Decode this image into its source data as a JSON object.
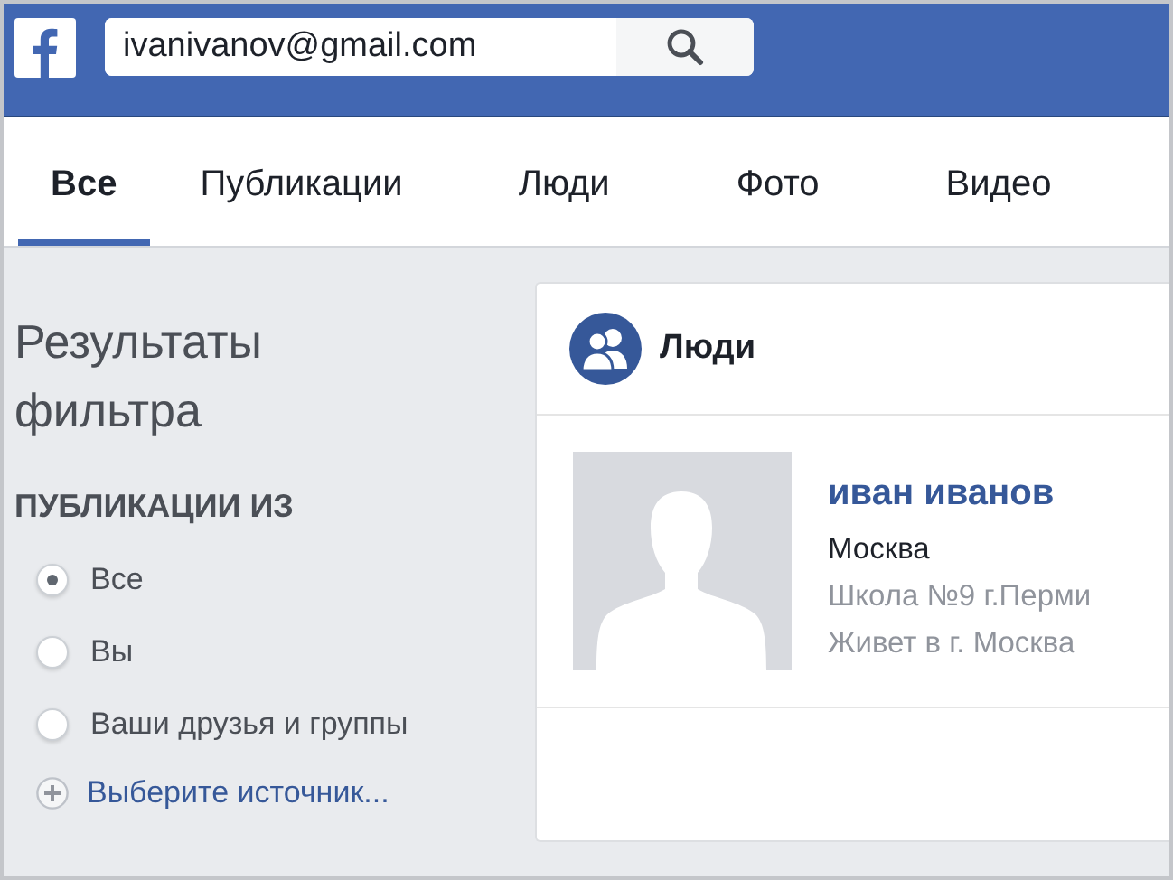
{
  "header": {
    "search": {
      "value": "ivanivanov@gmail.com"
    }
  },
  "tabs": [
    {
      "label": "Все",
      "selected": true
    },
    {
      "label": "Публикации",
      "selected": false
    },
    {
      "label": "Люди",
      "selected": false
    },
    {
      "label": "Фото",
      "selected": false
    },
    {
      "label": "Видео",
      "selected": false
    }
  ],
  "sidebar": {
    "title": "Результаты фильтра",
    "section": "ПУБЛИКАЦИИ ИЗ",
    "options": [
      {
        "label": "Все",
        "selected": true
      },
      {
        "label": "Вы",
        "selected": false
      },
      {
        "label": "Ваши друзья и группы",
        "selected": false
      }
    ],
    "add_source": "Выберите источник..."
  },
  "results": {
    "title": "Люди",
    "people": [
      {
        "name": "иван иванов",
        "lines": [
          "Москва",
          "Школа №9 г.Перми",
          "Живет в г. Москва"
        ]
      }
    ]
  }
}
